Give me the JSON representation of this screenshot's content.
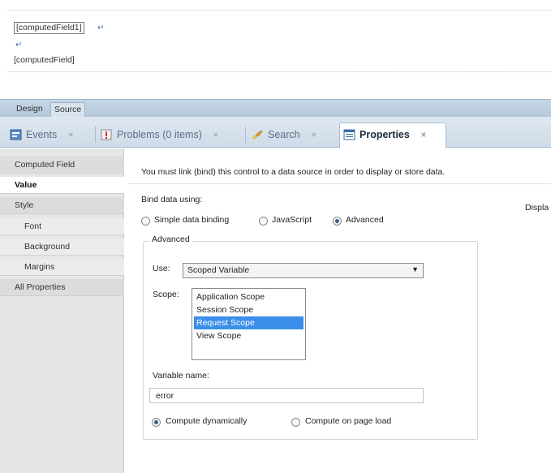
{
  "canvas": {
    "field1": "[computedField1]",
    "field2": "[computedField]"
  },
  "editor_tabs": {
    "design": "Design",
    "source": "Source"
  },
  "view_tabs": [
    {
      "label": "Events",
      "icon": "events-icon"
    },
    {
      "label": "Problems (0 items)",
      "icon": "problems-icon"
    },
    {
      "label": "Search",
      "icon": "search-icon"
    },
    {
      "label": "Properties",
      "icon": "properties-icon",
      "active": true
    }
  ],
  "close_glyph": "×",
  "left_nav": {
    "items": [
      "Computed Field",
      "Value",
      "Style",
      "Font",
      "Background",
      "Margins",
      "All Properties"
    ],
    "selected": "Value"
  },
  "main": {
    "message": "You must link (bind) this control to a data source in order to display or store data.",
    "display_cut": "Displa",
    "bind_label": "Bind data using:",
    "bind_options": [
      "Simple data binding",
      "JavaScript",
      "Advanced"
    ],
    "bind_selected": "Advanced",
    "group_title": "Advanced",
    "use_label": "Use:",
    "use_value": "Scoped Variable",
    "scope_label": "Scope:",
    "scope_options": [
      "Application Scope",
      "Session Scope",
      "Request Scope",
      "View Scope"
    ],
    "scope_selected": "Request Scope",
    "variable_label": "Variable name:",
    "variable_value": "error",
    "compute_options": [
      "Compute dynamically",
      "Compute on page load"
    ],
    "compute_selected": "Compute dynamically"
  },
  "colors": {
    "tab_strip": "#cfdbe8",
    "selection": "#3b8fea",
    "nav_bg": "#e6e6e6"
  }
}
